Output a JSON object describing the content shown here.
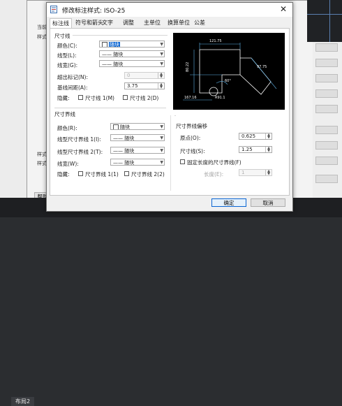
{
  "background": {
    "left_texts": [
      "当前",
      "样式",
      "样式",
      "样式",
      "帮助"
    ],
    "bottom_tab": "布局2",
    "cad_line_color": "#5a7fb0"
  },
  "dialog": {
    "title": "修改标注样式: ISO-25",
    "close_glyph": "✕",
    "tabs": [
      "标注线",
      "符号和箭头",
      "文字",
      "调整",
      "主单位",
      "换算单位",
      "公差"
    ],
    "dim_lines": {
      "group_title": "尺寸线",
      "color_label": "颜色(C):",
      "color_value": "随块",
      "linetype_label": "线型(L):",
      "linetype_value": "—— 随块",
      "lineweight_label": "线宽(G):",
      "lineweight_value": "—— 随块",
      "extend_label": "超出标记(N):",
      "extend_value": "0",
      "baseline_label": "基线间距(A):",
      "baseline_value": "3.75",
      "suppress_label": "隐藏:",
      "suppress_1": "尺寸线 1(M)",
      "suppress_2": "尺寸线 2(D)"
    },
    "ext_lines": {
      "group_title": "尺寸界线",
      "color_label": "颜色(R):",
      "color_value": "随块",
      "lt1_label": "线型尺寸界线 1(I):",
      "lt1_value": "—— 随块",
      "lt2_label": "线型尺寸界线 2(T):",
      "lt2_value": "—— 随块",
      "lineweight_label": "线宽(W):",
      "lineweight_value": "—— 随块",
      "suppress_label": "隐藏:",
      "suppress_1": "尺寸界线 1(1)",
      "suppress_2": "尺寸界线 2(2)"
    },
    "offsets": {
      "group_title": "尺寸界线偏移",
      "origin_label": "原点(O):",
      "origin_value": "0.625",
      "dimline_label": "尺寸线(S):",
      "dimline_value": "1.25",
      "fixed_label": "固定长度的尺寸界线(F)",
      "length_label": "长度(E):",
      "length_value": "1"
    },
    "preview": {
      "labels": [
        "121.75",
        "80.22",
        "97.75",
        "60°",
        "R91.1",
        "167.16"
      ],
      "line_color": "#ffffff",
      "dim_color": "#5fb3e8"
    },
    "ok_label": "确定",
    "cancel_label": "取消"
  }
}
